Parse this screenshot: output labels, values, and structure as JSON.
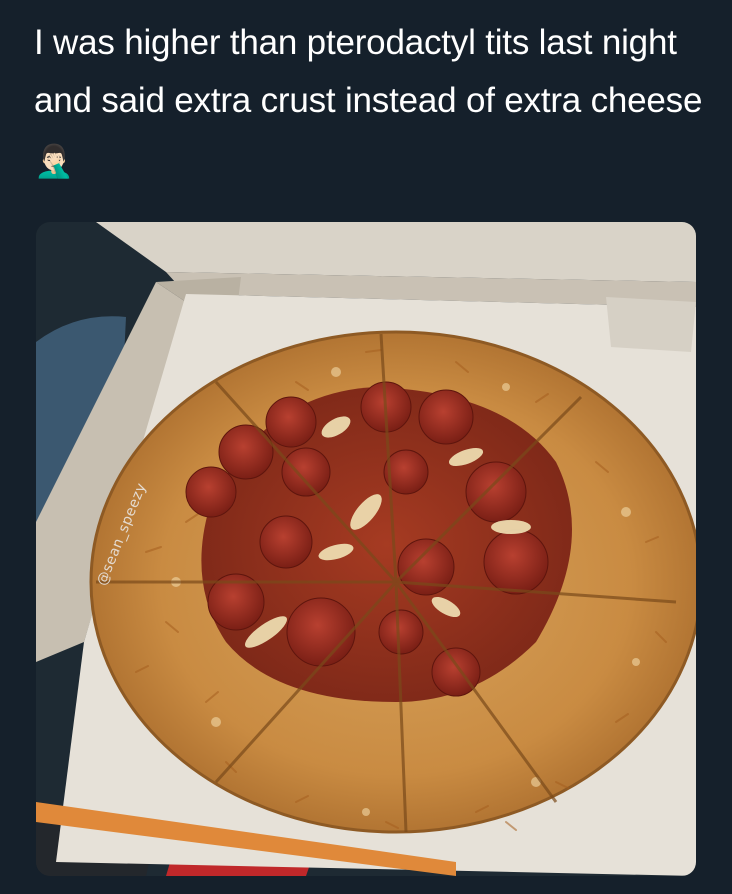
{
  "post": {
    "caption_text": "I was higher than pterodactyl tits last night and said extra crust instead of extra cheese",
    "emoji": "🤦🏻‍♂️",
    "emoji_name": "man-facepalming-emoji"
  },
  "photo": {
    "subject": "pepperoni pizza in open cardboard box",
    "watermark": "@sean_speezy"
  }
}
